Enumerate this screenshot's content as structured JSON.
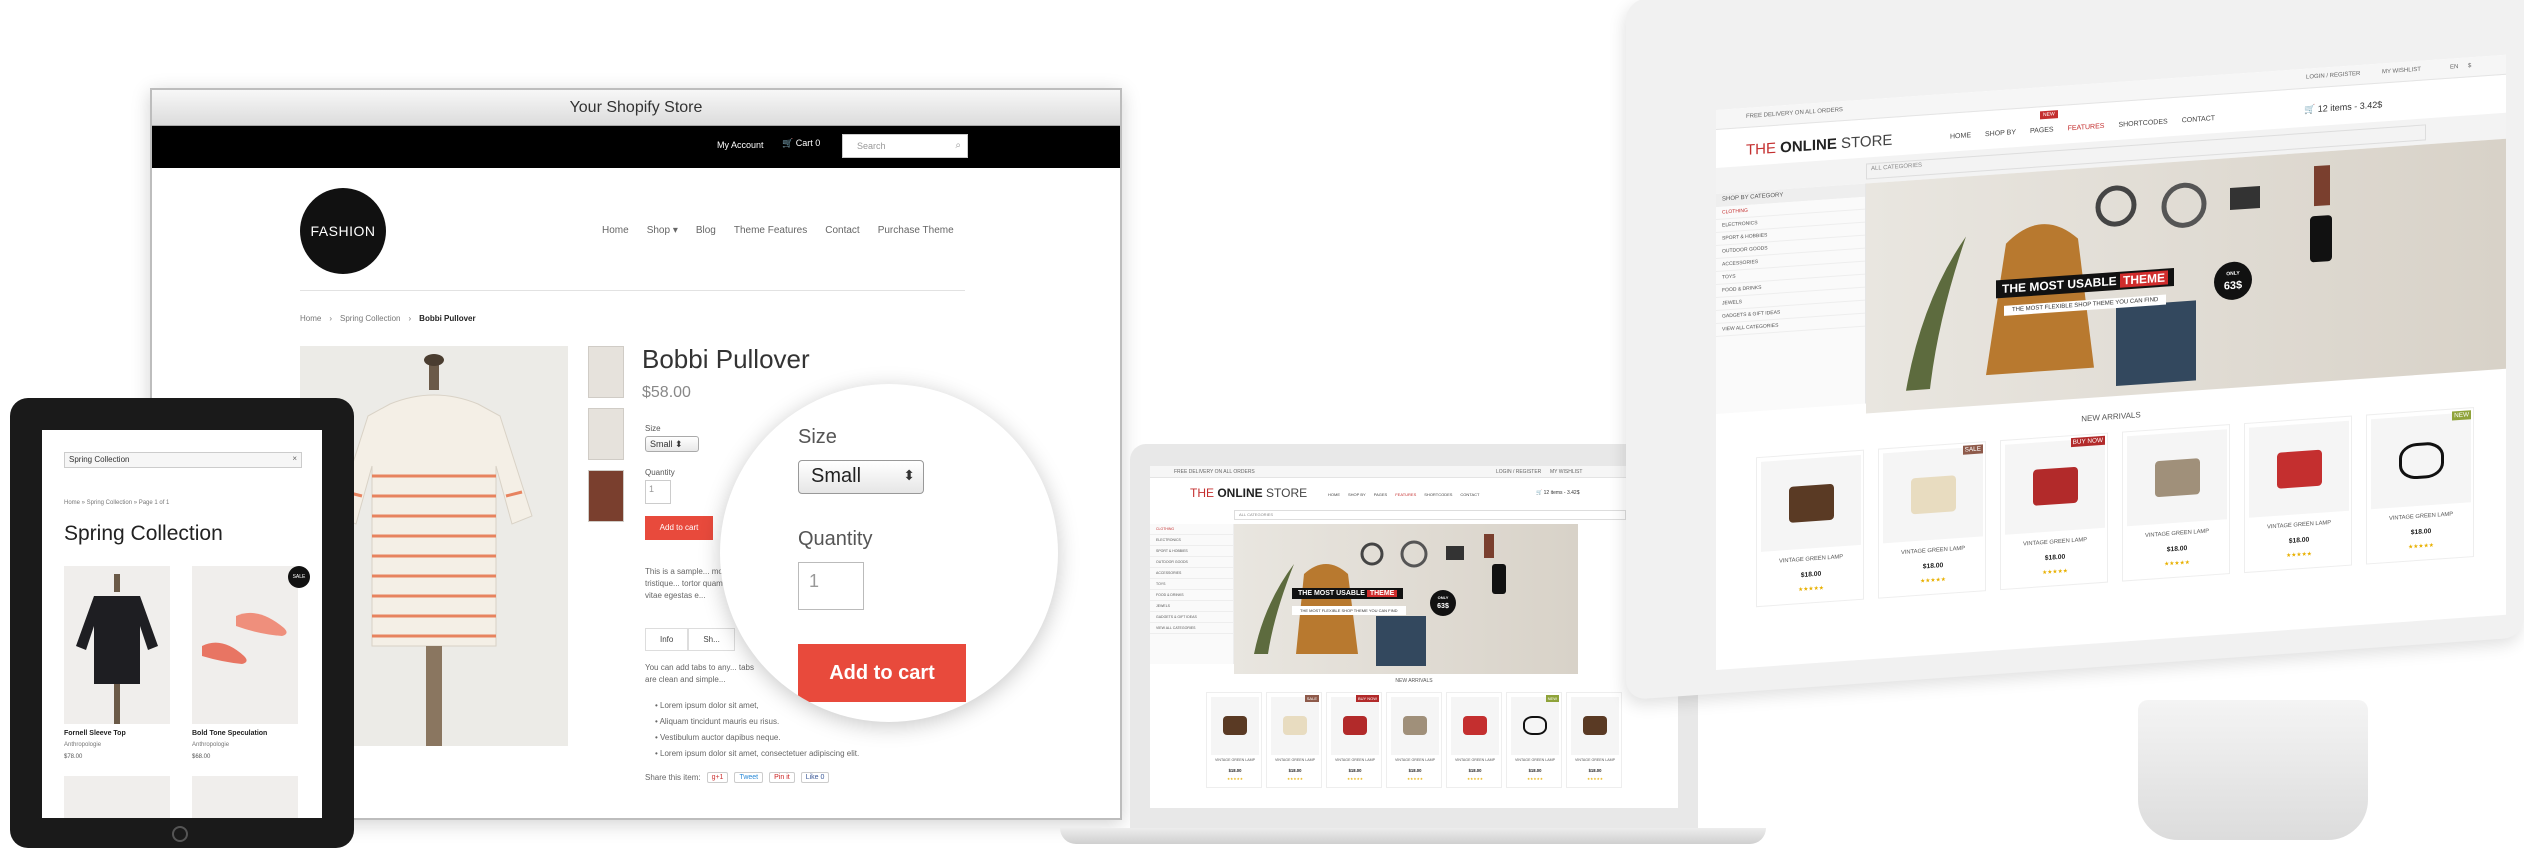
{
  "shopify": {
    "window_title": "Your Shopify Store",
    "topbar": {
      "account": "My Account",
      "cart": "Cart 0",
      "search_placeholder": "Search"
    },
    "logo": "FASHION",
    "nav": [
      "Home",
      "Shop ▾",
      "Blog",
      "Theme Features",
      "Contact",
      "Purchase Theme"
    ],
    "breadcrumb": [
      "Home",
      "Spring Collection",
      "Bobbi Pullover"
    ],
    "product": {
      "title": "Bobbi Pullover",
      "price": "$58.00",
      "size_label": "Size",
      "size_value": "Small",
      "quantity_label": "Quantity",
      "quantity_value": "1",
      "add_to_cart": "Add to cart",
      "description": "This is a sample... morbi tristique... tortor quam, feu... vitae egestas e...",
      "tabs": [
        "Info",
        "Sh..."
      ],
      "tab_text": "You can add tabs to any... tabs are clean and simple...",
      "bullets": [
        "Lorem ipsum dolor sit amet,",
        "Aliquam tincidunt mauris eu risus.",
        "Vestibulum auctor dapibus neque.",
        "Lorem ipsum dolor sit amet, consectetuer adipiscing elit."
      ],
      "share_label": "Share this item:",
      "share_buttons": [
        "g+1",
        "Tweet",
        "Pin it",
        "Like 0"
      ]
    },
    "magnifier": {
      "size_label": "Size",
      "size_value": "Small",
      "quantity_label": "Quantity",
      "quantity_value": "1",
      "add_to_cart": "Add to cart"
    }
  },
  "tablet": {
    "search_value": "Spring Collection",
    "breadcrumb": "Home  »  Spring Collection  »  Page 1 of 1",
    "title": "Spring Collection",
    "badge": "SALE",
    "products": [
      {
        "name": "Fornell Sleeve Top",
        "brand": "Anthropologie",
        "price": "$78.00"
      },
      {
        "name": "Bold Tone Speculation",
        "brand": "Anthropologie",
        "price": "$68.00"
      }
    ]
  },
  "store": {
    "logo_pre": "THE",
    "logo_main": "ONLINE",
    "logo_post": "STORE",
    "nav": [
      "HOME",
      "SHOP BY",
      "PAGES",
      "FEATURES",
      "SHORTCODES",
      "CONTACT"
    ],
    "hot_badge": "NEW",
    "cart": "12 items - 3.42$",
    "topbar_left": "FREE DELIVERY ON ALL ORDERS",
    "topbar_right": [
      "LOGIN / REGISTER",
      "MY WISHLIST",
      "EN",
      "$"
    ],
    "category_label": "SHOP BY CATEGORY",
    "all_categories": "ALL CATEGORIES",
    "categories": [
      "CLOTHING",
      "ELECTRONICS",
      "SPORT & HOBBIES",
      "OUTDOOR GOODS",
      "ACCESSORIES",
      "TOYS",
      "FOOD & DRINKS",
      "JEWELS",
      "GADGETS & GIFT IDEAS",
      "VIEW ALL CATEGORIES"
    ],
    "hero_title_a": "THE MOST USABLE",
    "hero_title_b": "THEME",
    "hero_sub": "THE MOST FLEXIBLE SHOP THEME YOU CAN FIND",
    "only_label": "ONLY",
    "only_price": "63$",
    "new_arrivals": "NEW ARRIVALS",
    "product_name": "VINTAGE GREEN LAMP",
    "product_price": "$18.00",
    "stars": "★★★★★",
    "sale_badge": "SALE",
    "new_badge": "NEW",
    "buy_badge": "BUY NOW"
  },
  "colors": {
    "accent_red": "#e84a3c",
    "dark": "#111111",
    "store_red": "#c42f2f"
  }
}
